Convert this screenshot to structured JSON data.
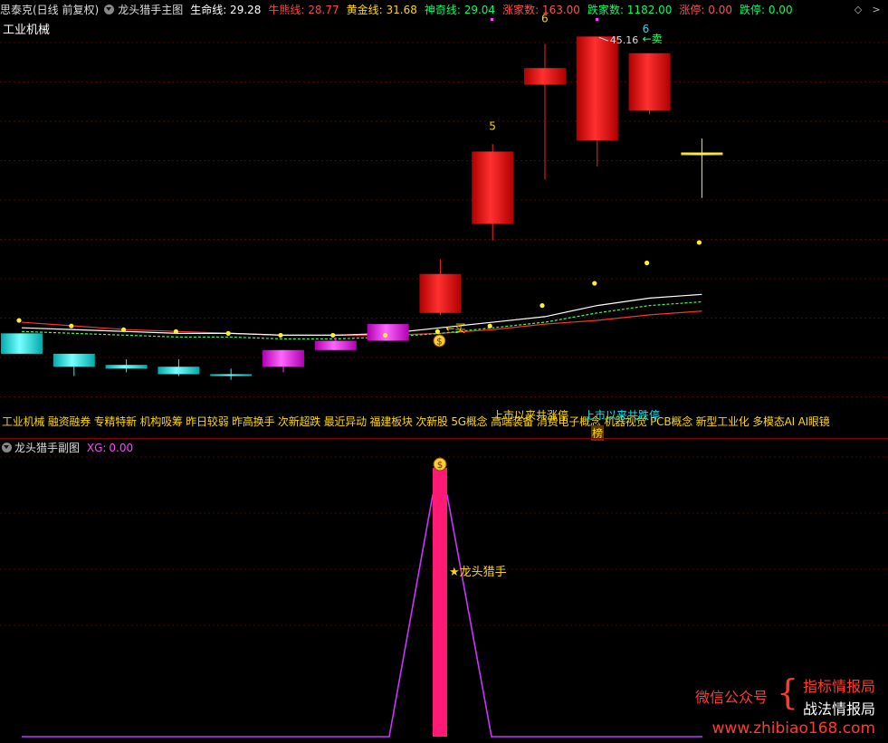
{
  "header": {
    "stock_name": "思泰克(日线 前复权)",
    "indicator_name": "龙头猎手主图",
    "items": [
      {
        "label": "生命线:",
        "value": "29.28",
        "color": "#ffffff"
      },
      {
        "label": "牛熊线:",
        "value": "28.77",
        "color": "#ff4040"
      },
      {
        "label": "黄金线:",
        "value": "31.68",
        "color": "#ffd700"
      },
      {
        "label": "神奇线:",
        "value": "29.04",
        "color": "#00ff66"
      },
      {
        "label": "涨家数:",
        "value": "163.00",
        "color": "#ff5050"
      },
      {
        "label": "跌家数:",
        "value": "1182.00",
        "color": "#00ff66"
      },
      {
        "label": "涨停:",
        "value": "0.00",
        "color": "#ff5050"
      },
      {
        "label": "跌停:",
        "value": "0.00",
        "color": "#00ff66"
      }
    ],
    "sector": "工业机械"
  },
  "annotations": {
    "high_price": "45.16",
    "sell_mark": "←卖",
    "buy_mark": "←买",
    "count_5": "5",
    "count_6a": "6",
    "count_6b": "6",
    "limit_up": "上市以来共涨停",
    "limit_down": "上市以来共跌停",
    "bang": "榜"
  },
  "concepts": "工业机械 融资融券 专精特新 机构吸筹 昨日较弱 昨高换手 次新超跌 最近异动 福建板块 次新股 5G概念 高端装备 消费电子概念 机器视觉 PCB概念 新型工业化 多模态AI AI眼镜",
  "sub_chart": {
    "title": "龙头猎手副图",
    "xg_label": "XG:",
    "xg_value": "0.00",
    "signal_label": "★龙头猎手"
  },
  "watermark": {
    "left": "微信公众号",
    "line1": "指标情报局",
    "line2": "战法情报局",
    "url": "www.zhibiao168.com"
  },
  "chart_data": {
    "type": "candlestick",
    "candles": [
      {
        "o": 29.3,
        "c": 28.2,
        "h": 29.3,
        "l": 28.2,
        "color": "cyan"
      },
      {
        "o": 28.2,
        "c": 27.5,
        "h": 28.2,
        "l": 27.0,
        "color": "cyan"
      },
      {
        "o": 27.6,
        "c": 27.4,
        "h": 27.9,
        "l": 27.2,
        "color": "cyan"
      },
      {
        "o": 27.5,
        "c": 27.1,
        "h": 27.9,
        "l": 27.0,
        "color": "cyan"
      },
      {
        "o": 27.1,
        "c": 27.0,
        "h": 27.4,
        "l": 26.8,
        "color": "cyan"
      },
      {
        "o": 27.5,
        "c": 28.4,
        "h": 28.4,
        "l": 27.2,
        "color": "magenta"
      },
      {
        "o": 28.4,
        "c": 28.9,
        "h": 29.1,
        "l": 28.4,
        "color": "magenta"
      },
      {
        "o": 28.9,
        "c": 29.8,
        "h": 29.8,
        "l": 28.9,
        "color": "magenta"
      },
      {
        "o": 30.4,
        "c": 32.5,
        "h": 33.3,
        "l": 30.3,
        "color": "red"
      },
      {
        "o": 35.2,
        "c": 39.1,
        "h": 39.5,
        "l": 34.3,
        "color": "red"
      },
      {
        "o": 43.6,
        "c": 42.7,
        "h": 44.9,
        "l": 37.6,
        "color": "red"
      },
      {
        "o": 45.3,
        "c": 39.7,
        "h": 45.16,
        "l": 38.3,
        "color": "red"
      },
      {
        "o": 44.4,
        "c": 41.3,
        "h": 44.4,
        "l": 41.1,
        "color": "red"
      },
      {
        "o": 39.0,
        "c": 39.0,
        "h": 39.8,
        "l": 36.6,
        "color": "yellow"
      }
    ],
    "dots": [
      29.9,
      29.6,
      29.4,
      29.3,
      29.2,
      29.1,
      29.1,
      29.1,
      29.3,
      29.6,
      30.7,
      31.9,
      33.0,
      34.1,
      35.2
    ]
  }
}
